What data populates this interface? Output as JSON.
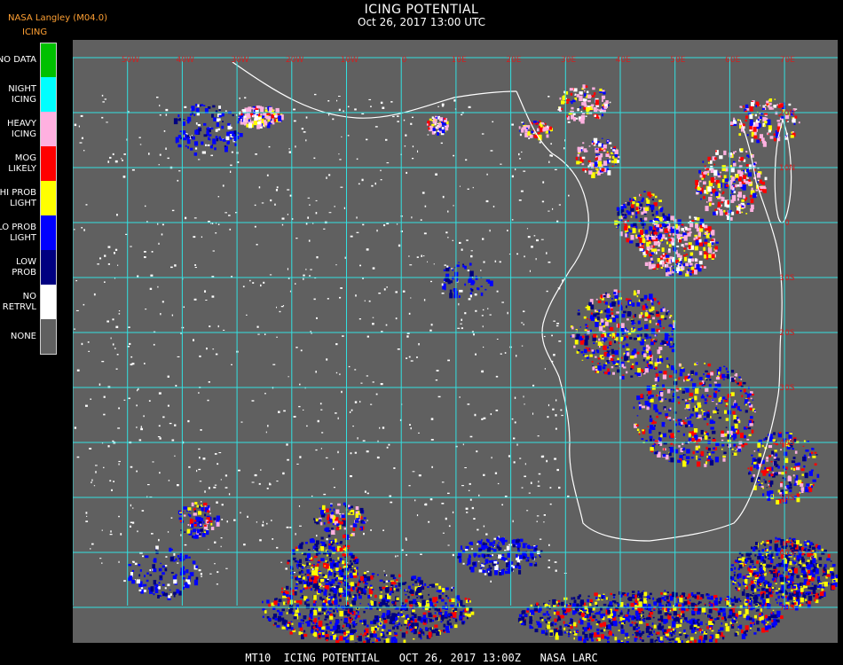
{
  "header": {
    "title": "ICING POTENTIAL",
    "datetime": "Oct 26, 2017 13:00 UTC",
    "provider": "NASA Langley (M04.0)",
    "product": "ICING"
  },
  "legend": [
    {
      "label": [
        "NO DATA"
      ],
      "color": "#00c000"
    },
    {
      "label": [
        "NIGHT",
        "ICING"
      ],
      "color": "#00ffff"
    },
    {
      "label": [
        "HEAVY",
        "ICING"
      ],
      "color": "#ffb0e0"
    },
    {
      "label": [
        "MOG",
        "LIKELY"
      ],
      "color": "#ff0000"
    },
    {
      "label": [
        "HI PROB",
        "LIGHT"
      ],
      "color": "#ffff00"
    },
    {
      "label": [
        "LO PROB",
        "LIGHT"
      ],
      "color": "#0000ff"
    },
    {
      "label": [
        "LOW",
        "PROB"
      ],
      "color": "#000080"
    },
    {
      "label": [
        "NO",
        "RETRVL"
      ],
      "color": "#ffffff"
    },
    {
      "label": [
        "NONE"
      ],
      "color": "#606060"
    }
  ],
  "colors": {
    "map_background": "#606060",
    "grid": "#33e0e0",
    "coastline": "#ffffff",
    "grid_label": "#d02020"
  },
  "grid_labels": {
    "longitude": [
      "50W",
      "40W",
      "30W",
      "20W",
      "10W",
      "0",
      "10E",
      "20E",
      "30E",
      "40E",
      "50E",
      "60E",
      "70E"
    ],
    "latitude": [
      "20N",
      "10N",
      "0",
      "10S",
      "20S",
      "30S",
      "40S",
      "50S",
      "60S",
      "70S",
      "80S"
    ]
  },
  "footer": "MT10  ICING POTENTIAL   OCT 26, 2017 13:00Z   NASA LARC"
}
